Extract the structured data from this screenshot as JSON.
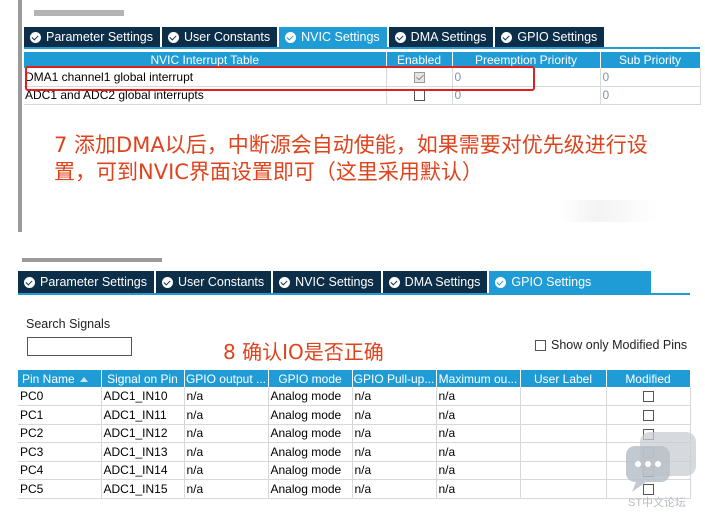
{
  "panel1": {
    "tabs": [
      {
        "label": "Parameter Settings",
        "active": false
      },
      {
        "label": "User Constants",
        "active": false
      },
      {
        "label": "NVIC Settings",
        "active": true
      },
      {
        "label": "DMA Settings",
        "active": false
      },
      {
        "label": "GPIO Settings",
        "active": false
      }
    ],
    "table": {
      "headers": [
        "NVIC Interrupt Table",
        "Enabled",
        "Preemption Priority",
        "Sub Priority"
      ],
      "rows": [
        {
          "name": "DMA1 channel1 global interrupt",
          "enabled": true,
          "preemption": "0",
          "sub": "0"
        },
        {
          "name": "ADC1 and ADC2 global interrupts",
          "enabled": false,
          "preemption": "0",
          "sub": "0"
        }
      ]
    },
    "note_line1": "7 添加DMA以后，中断源会自动使能，如果需要对优先级进行设",
    "note_line2": "置，可到NVIC界面设置即可（这里采用默认）"
  },
  "panel2": {
    "tabs": [
      {
        "label": "Parameter Settings",
        "active": false
      },
      {
        "label": "User Constants",
        "active": false
      },
      {
        "label": "NVIC Settings",
        "active": false
      },
      {
        "label": "DMA Settings",
        "active": false
      },
      {
        "label": "GPIO Settings",
        "active": true
      }
    ],
    "search_label": "Search Signals",
    "search_value": "",
    "note": "8 确认IO是否正确",
    "show_modified_label": "Show only Modified Pins",
    "table": {
      "headers": [
        "Pin Name",
        "Signal on Pin",
        "GPIO output ...",
        "GPIO mode",
        "GPIO Pull-up...",
        "Maximum ou...",
        "User Label",
        "Modified"
      ],
      "rows": [
        {
          "pin": "PC0",
          "signal": "ADC1_IN10",
          "output": "n/a",
          "mode": "Analog mode",
          "pull": "n/a",
          "max": "n/a",
          "label": "",
          "modified": false
        },
        {
          "pin": "PC1",
          "signal": "ADC1_IN11",
          "output": "n/a",
          "mode": "Analog mode",
          "pull": "n/a",
          "max": "n/a",
          "label": "",
          "modified": false
        },
        {
          "pin": "PC2",
          "signal": "ADC1_IN12",
          "output": "n/a",
          "mode": "Analog mode",
          "pull": "n/a",
          "max": "n/a",
          "label": "",
          "modified": false
        },
        {
          "pin": "PC3",
          "signal": "ADC1_IN13",
          "output": "n/a",
          "mode": "Analog mode",
          "pull": "n/a",
          "max": "n/a",
          "label": "",
          "modified": false
        },
        {
          "pin": "PC4",
          "signal": "ADC1_IN14",
          "output": "n/a",
          "mode": "Analog mode",
          "pull": "n/a",
          "max": "n/a",
          "label": "",
          "modified": false
        },
        {
          "pin": "PC5",
          "signal": "ADC1_IN15",
          "output": "n/a",
          "mode": "Analog mode",
          "pull": "n/a",
          "max": "n/a",
          "label": "",
          "modified": false
        }
      ]
    }
  },
  "watermark": "ST中文论坛",
  "colors": {
    "tab_dark": "#0d2e48",
    "tab_active": "#1f9bd6",
    "note_red": "#e0431c",
    "highlight_red": "#e02020"
  }
}
